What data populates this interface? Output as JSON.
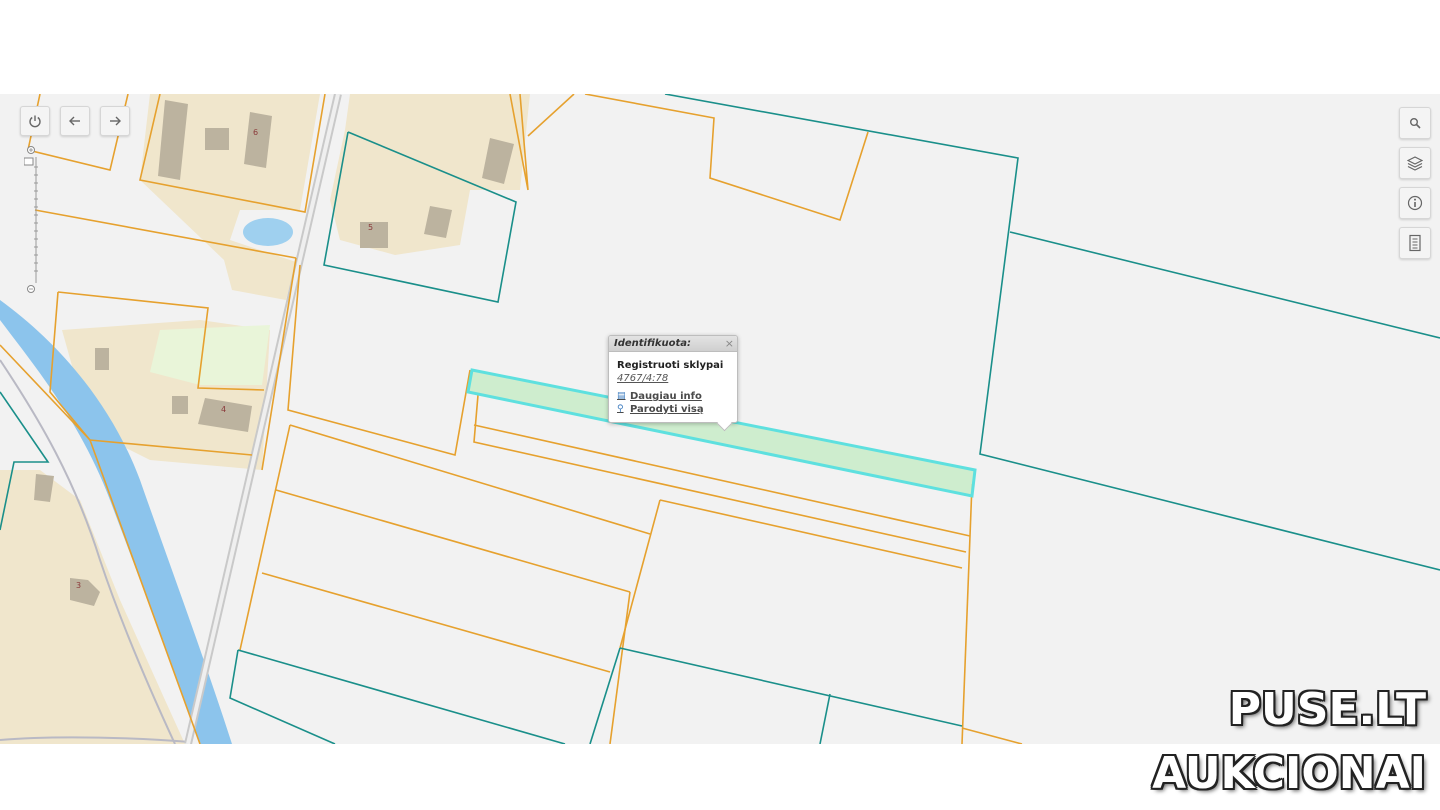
{
  "popup": {
    "title": "Identifikuota:",
    "close": "×",
    "layer_name": "Registruoti sklypai",
    "parcel_id": "4767/4:78",
    "more_info": "Daugiau info",
    "show_all": "Parodyti visą"
  },
  "labels": {
    "house_6": "6",
    "house_5": "5",
    "house_4": "4",
    "house_3": "3"
  },
  "toolbar_left": {
    "buttons": [
      "power-icon",
      "arrow-left-icon",
      "arrow-right-icon"
    ]
  },
  "toolbar_right": {
    "buttons": [
      "search-icon",
      "layers-icon",
      "info-icon",
      "legend-icon"
    ]
  },
  "watermark": {
    "line1": "PUSE.LT",
    "line2": "AUKCIONAI"
  },
  "colors": {
    "parcel_orange": "#e6a12e",
    "parcel_teal": "#1a8f8a",
    "highlight_fill": "#c8ecc8",
    "highlight_stroke": "#5ee0df",
    "river": "#8cc4ec",
    "built_area": "#f0e6cc",
    "building": "#bcb39f"
  }
}
